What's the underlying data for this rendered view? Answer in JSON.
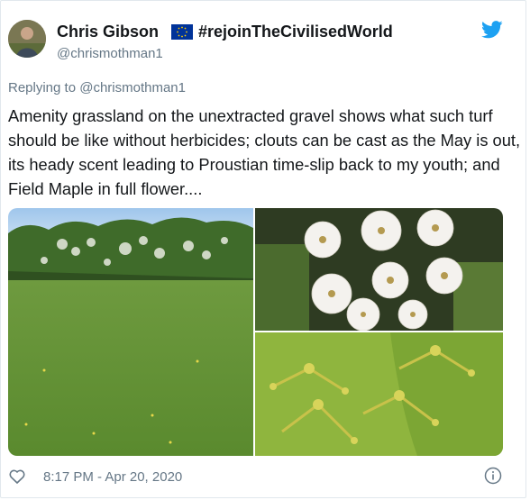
{
  "tweet": {
    "author_name": "Chris Gibson",
    "flag_icon": "eu-flag-icon",
    "hashtag_name": "#rejoinTheCivilisedWorld",
    "handle": "@chrismothman1",
    "replying_prefix": "Replying to",
    "replying_to": "@chrismothman1",
    "text": "Amenity grassland on the unextracted gravel shows what such turf should be like without herbicides; clouts can be cast as the May is out, its heady scent leading to Proustian time-slip back to my youth; and Field Maple in full flower....",
    "timestamp": "8:17 PM - Apr 20, 2020"
  },
  "icons": {
    "logo": "twitter-bird-icon",
    "like": "heart-icon",
    "info": "info-icon",
    "brand_color": "#1da1f2"
  },
  "media": [
    {
      "name": "grassland-photo"
    },
    {
      "name": "hawthorn-flowers-photo"
    },
    {
      "name": "field-maple-flowers-photo"
    }
  ]
}
